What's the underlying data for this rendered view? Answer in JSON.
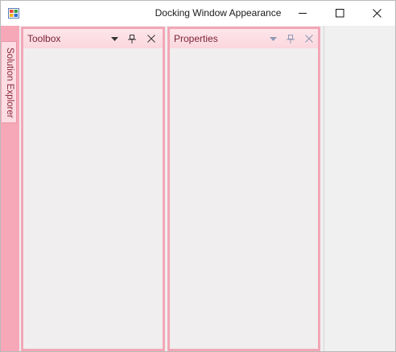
{
  "window": {
    "title": "Docking Window Appearance"
  },
  "side_tab": {
    "label": "Solution Explorer"
  },
  "panels": [
    {
      "title": "Toolbox"
    },
    {
      "title": "Properties"
    }
  ],
  "colors": {
    "accent": "#f3a7b6",
    "header": "#fbd7de",
    "title_text": "#7a1f33",
    "icon_active": "#333333",
    "icon_inactive": "#8c97b4"
  },
  "icons": {
    "app": "app-icon",
    "minimize": "minimize-icon",
    "maximize": "maximize-icon",
    "close": "close-icon",
    "dropdown": "chevron-down-icon",
    "pin": "pin-icon"
  }
}
